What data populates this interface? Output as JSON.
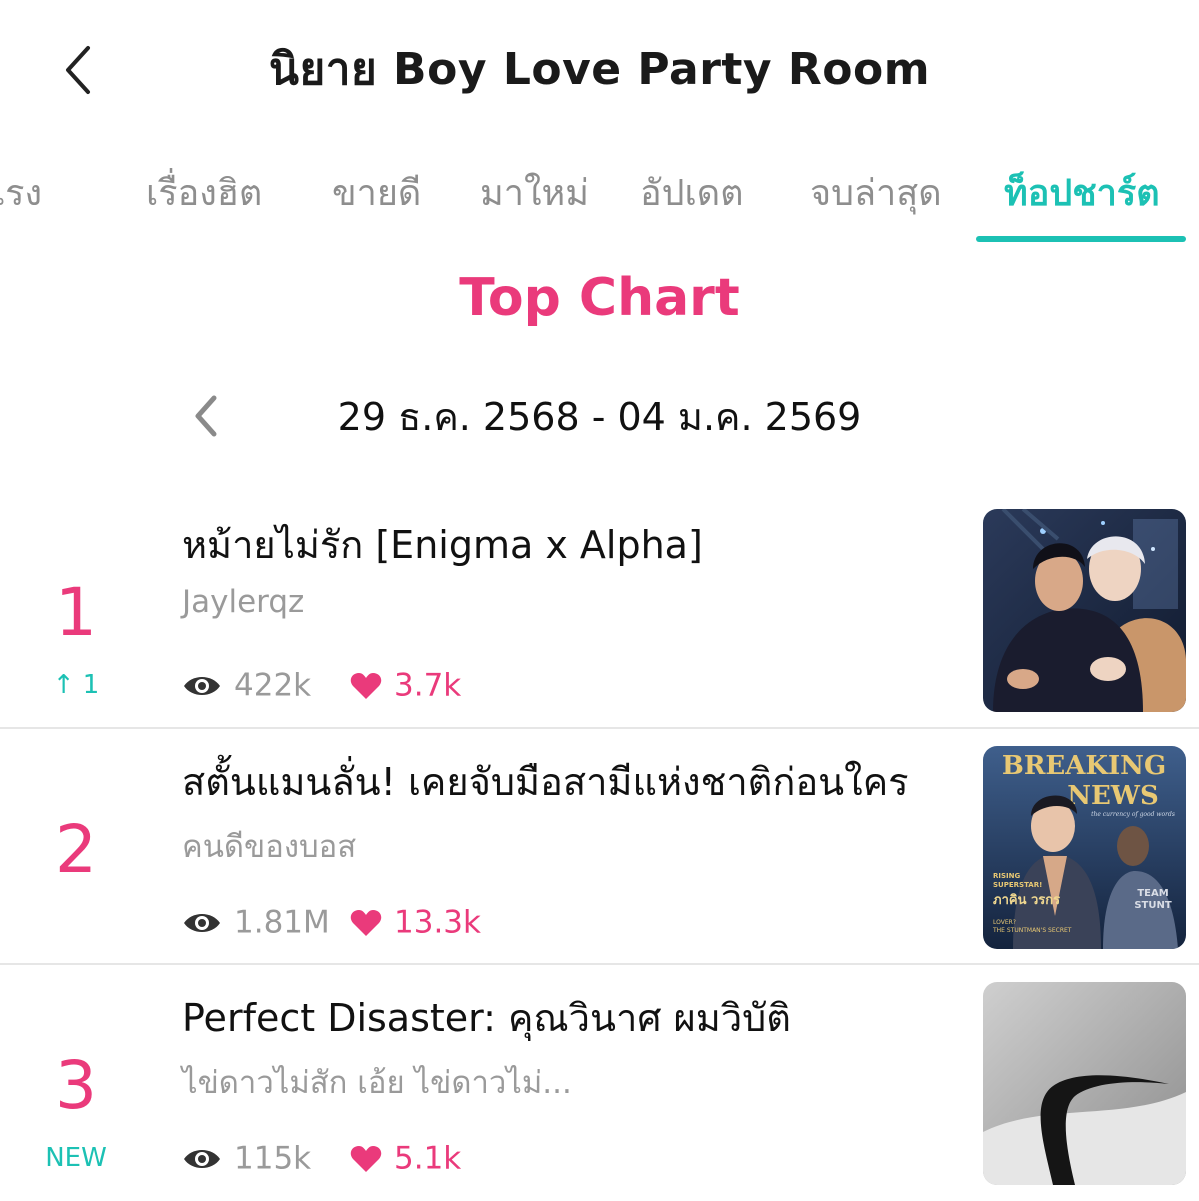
{
  "header": {
    "title": "นิยาย Boy Love Party Room",
    "back_icon": "chevron-left-icon"
  },
  "tabs": [
    {
      "label": "มาแรง",
      "active": false
    },
    {
      "label": "เรื่องฮิต",
      "active": false
    },
    {
      "label": "ขายดี",
      "active": false
    },
    {
      "label": "มาใหม่",
      "active": false
    },
    {
      "label": "อัปเดต",
      "active": false
    },
    {
      "label": "จบล่าสุด",
      "active": false
    },
    {
      "label": "ท็อปชาร์ต",
      "active": true
    }
  ],
  "chart": {
    "title": "Top Chart",
    "date_range": "29 ธ.ค. 2568 - 04 ม.ค. 2569",
    "prev_icon": "chevron-left-icon"
  },
  "items": [
    {
      "rank": "1",
      "change": "↑ 1",
      "title": "หม้ายไม่รัก [Enigma x Alpha]",
      "author": "Jaylerqz",
      "views": "422k",
      "likes": "3.7k"
    },
    {
      "rank": "2",
      "change": "",
      "title": "สตั้นแมนลั่น! เคยจับมือสามีแห่งชาติก่อนใคร",
      "author": "คนดีของบอส",
      "views": "1.81M",
      "likes": "13.3k",
      "cover_text": {
        "headline1": "BREAKING",
        "headline2": "NEWS",
        "tagline": "the currency of good words",
        "rising": "RISING",
        "superstar": "SUPERSTAR!",
        "name": "ภาคิน วรกร",
        "lover": "LOVER?",
        "secret": "THE STUNTMAN'S SECRET",
        "team1": "TEAM",
        "team2": "STUNT"
      }
    },
    {
      "rank": "3",
      "change": "NEW",
      "title": "Perfect Disaster: คุณวินาศ ผมวิบัติ",
      "author": "ไข่ดาวไม่สัก เอ้ย ไข่ดาวไม่...",
      "views": "115k",
      "likes": "5.1k"
    }
  ],
  "colors": {
    "accent_teal": "#1cc1b4",
    "accent_pink": "#ea3a7b",
    "muted": "#9a9a9a"
  }
}
